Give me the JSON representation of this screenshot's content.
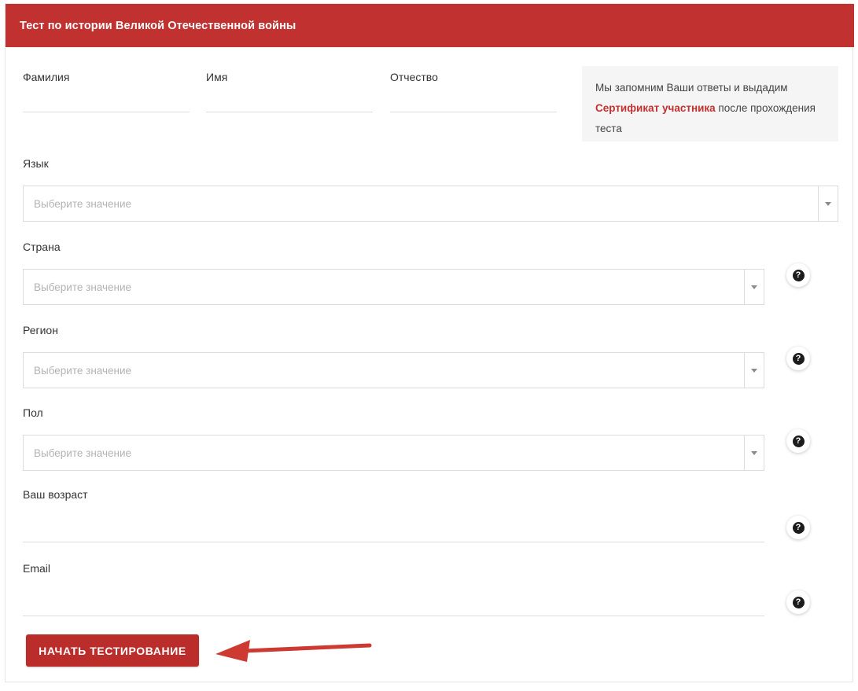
{
  "header": {
    "title": "Тест по истории Великой Отечественной войны",
    "background_color": "#c1312f",
    "text_color": "#ffffff"
  },
  "info_box": {
    "text_before": "Мы запомним Ваши ответы и выдадим ",
    "highlight": "Сертификат участника",
    "text_after": " после прохождения теста",
    "highlight_color": "#c1312f",
    "background_color": "#f5f5f5"
  },
  "name_fields": [
    {
      "label": "Фамилия",
      "value": "",
      "placeholder": ""
    },
    {
      "label": "Имя",
      "value": "",
      "placeholder": ""
    },
    {
      "label": "Отчество",
      "value": "",
      "placeholder": ""
    }
  ],
  "selects": {
    "language": {
      "label": "Язык",
      "placeholder": "Выберите значение",
      "value": ""
    },
    "country": {
      "label": "Страна",
      "placeholder": "Выберите значение",
      "value": ""
    },
    "region": {
      "label": "Регион",
      "placeholder": "Выберите значение",
      "value": ""
    },
    "gender": {
      "label": "Пол",
      "placeholder": "Выберите значение",
      "value": ""
    }
  },
  "text_inputs": {
    "age": {
      "label": "Ваш возраст",
      "value": "",
      "placeholder": ""
    },
    "email": {
      "label": "Email",
      "value": "",
      "placeholder": ""
    }
  },
  "help": {
    "glyph": "?",
    "icon_name": "question-mark-icon"
  },
  "submit": {
    "label": "НАЧАТЬ ТЕСТИРОВАНИЕ",
    "background_color": "#bb2d2b",
    "text_color": "#ffffff"
  },
  "annotation": {
    "type": "arrow",
    "direction": "left",
    "color": "#cc3a32",
    "points_to": "НАЧАТЬ ТЕСТИРОВАНИЕ"
  }
}
